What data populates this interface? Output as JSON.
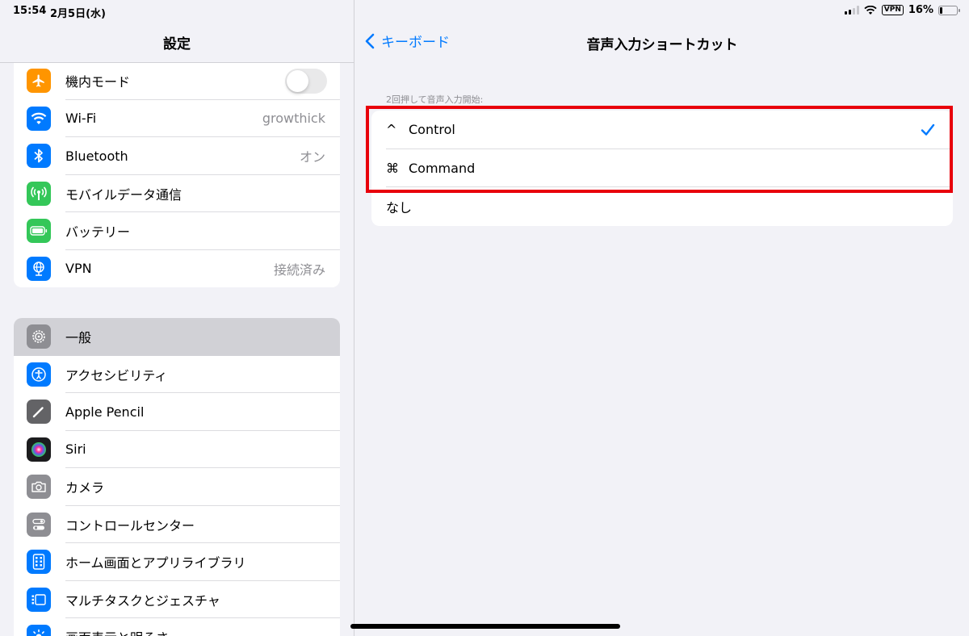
{
  "status": {
    "time": "15:54",
    "date": "2月5日(水)",
    "vpn": "VPN",
    "battery": "16%",
    "battery_fraction": 0.16
  },
  "sidebar": {
    "title": "設定",
    "group1": [
      {
        "label": "機内モード",
        "icon": "airplane-icon",
        "color": "#ff9500",
        "toggle": false
      },
      {
        "label": "Wi-Fi",
        "icon": "wifi-icon",
        "color": "#007aff",
        "value": "growthick"
      },
      {
        "label": "Bluetooth",
        "icon": "bluetooth-icon",
        "color": "#007aff",
        "value": "オン"
      },
      {
        "label": "モバイルデータ通信",
        "icon": "antenna-icon",
        "color": "#34c759"
      },
      {
        "label": "バッテリー",
        "icon": "battery-icon",
        "color": "#34c759"
      },
      {
        "label": "VPN",
        "icon": "globe-icon",
        "color": "#007aff",
        "value": "接続済み"
      }
    ],
    "group2": [
      {
        "label": "一般",
        "icon": "gear-icon",
        "color": "#8e8e93",
        "selected": true
      },
      {
        "label": "アクセシビリティ",
        "icon": "accessibility-icon",
        "color": "#007aff"
      },
      {
        "label": "Apple Pencil",
        "icon": "pencil-icon",
        "color": "#636366"
      },
      {
        "label": "Siri",
        "icon": "siri-icon",
        "color": "#1c1c1e"
      },
      {
        "label": "カメラ",
        "icon": "camera-icon",
        "color": "#8e8e93"
      },
      {
        "label": "コントロールセンター",
        "icon": "toggles-icon",
        "color": "#8e8e93"
      },
      {
        "label": "ホーム画面とアプリライブラリ",
        "icon": "home-grid-icon",
        "color": "#007aff"
      },
      {
        "label": "マルチタスクとジェスチャ",
        "icon": "multitask-icon",
        "color": "#007aff"
      },
      {
        "label": "画面表示と明るさ",
        "icon": "sun-icon",
        "color": "#007aff"
      }
    ]
  },
  "detail": {
    "back_label": "キーボード",
    "title": "音声入力ショートカット",
    "section_label": "2回押して音声入力開始:",
    "options": [
      {
        "symbol": "^",
        "label": "Control",
        "checked": true
      },
      {
        "symbol": "⌘",
        "label": "Command",
        "checked": false
      },
      {
        "symbol": "",
        "label": "なし",
        "checked": false
      }
    ]
  },
  "colors": {
    "accent": "#007aff",
    "highlight": "#e8000b"
  }
}
